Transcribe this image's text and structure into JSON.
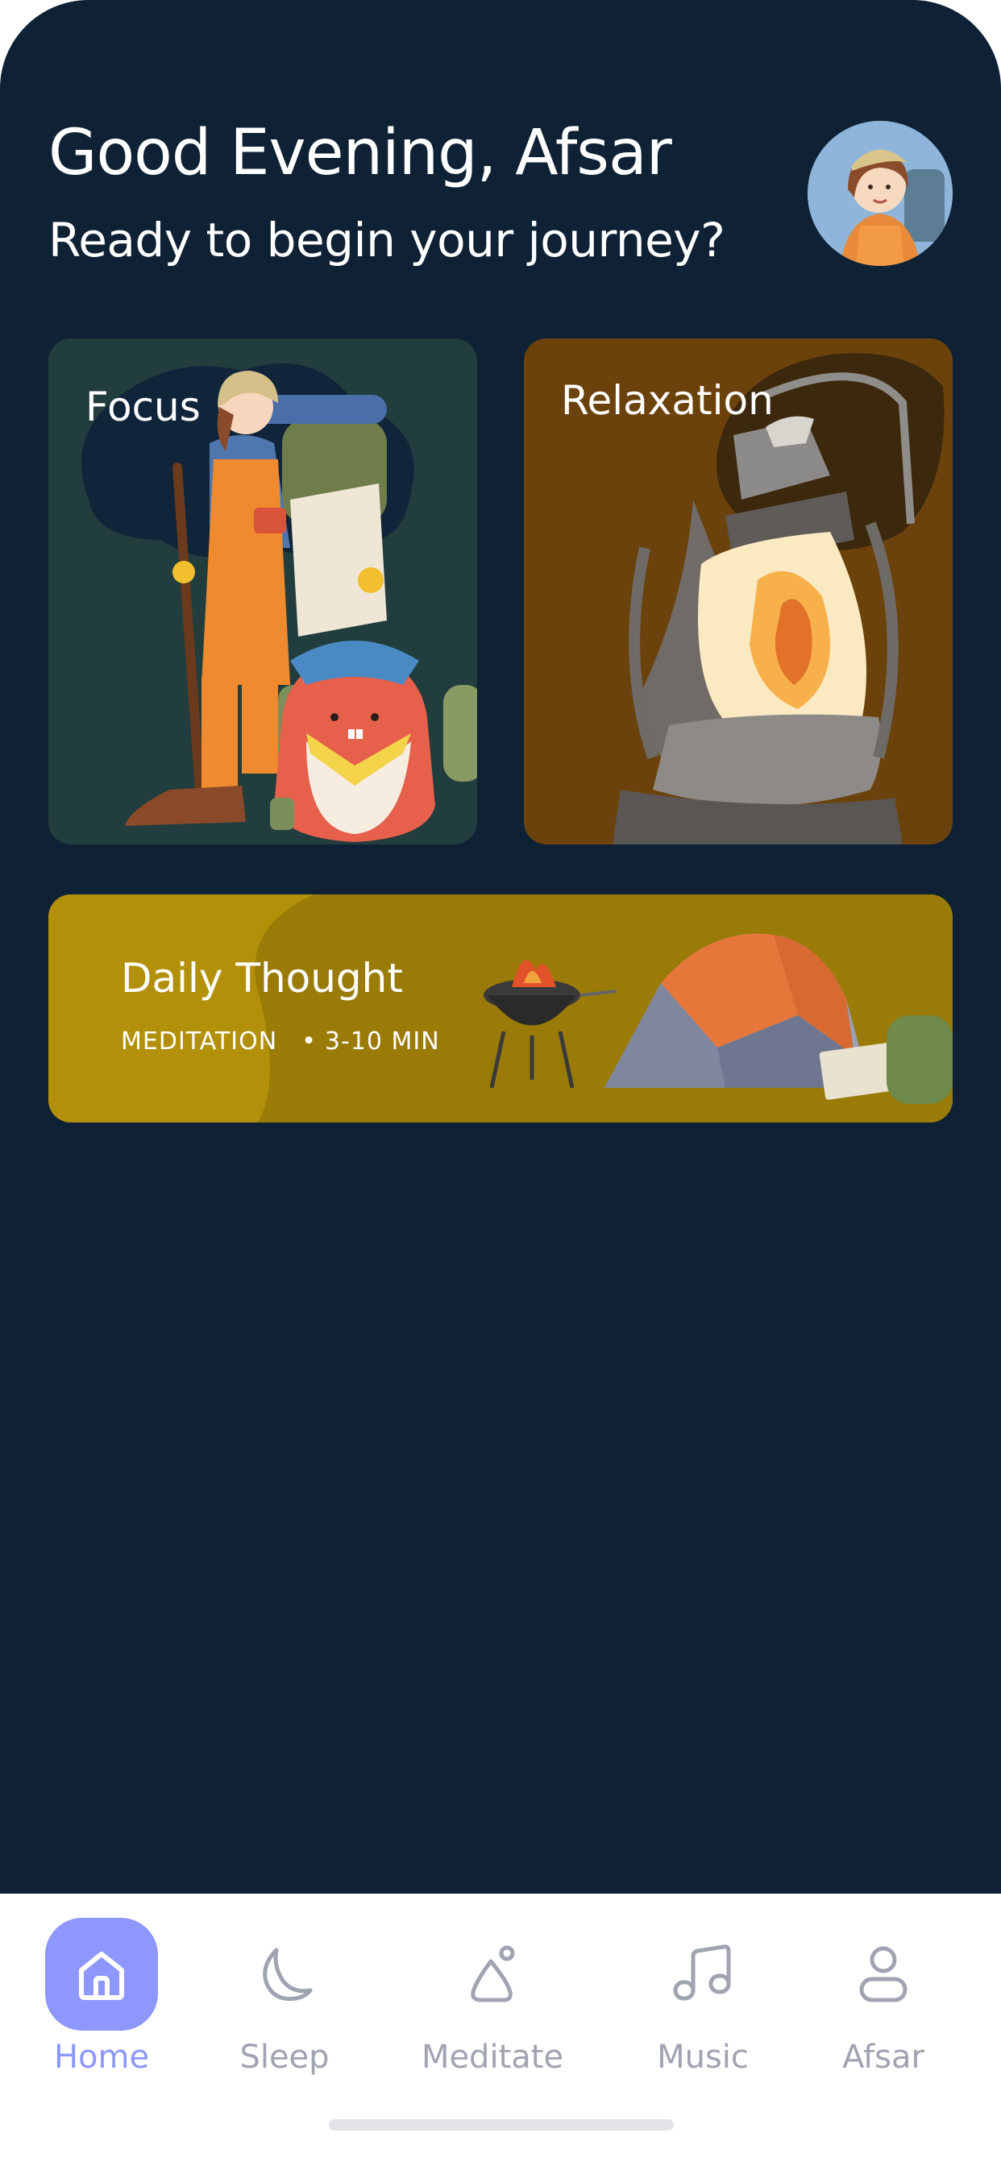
{
  "header": {
    "greeting": "Good Evening, Afsar",
    "subtitle": "Ready to begin your journey?",
    "avatar_icon": "avatar-illustration"
  },
  "cards": {
    "focus": {
      "title": "Focus",
      "color": "#213d3d"
    },
    "relaxation": {
      "title": "Relaxation",
      "color": "#6b420c"
    },
    "daily": {
      "title": "Daily Thought",
      "category": "MEDITATION",
      "separator": "•",
      "duration": "3-10 MIN",
      "color": "#9a7b07"
    }
  },
  "tabs": [
    {
      "label": "Home",
      "icon": "home-icon",
      "active": true
    },
    {
      "label": "Sleep",
      "icon": "moon-icon",
      "active": false
    },
    {
      "label": "Meditate",
      "icon": "meditate-icon",
      "active": false
    },
    {
      "label": "Music",
      "icon": "music-icon",
      "active": false
    },
    {
      "label": "Afsar",
      "icon": "profile-icon",
      "active": false
    }
  ],
  "colors": {
    "background": "#0f2134",
    "accent": "#8e97fd",
    "tab_inactive": "#a0a3b1"
  }
}
